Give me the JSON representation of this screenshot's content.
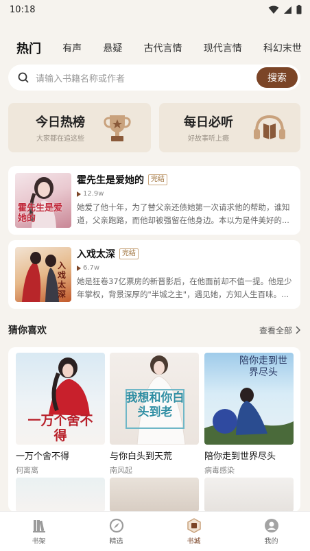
{
  "status": {
    "time": "10:18"
  },
  "tabs": [
    {
      "label": "热门",
      "active": true
    },
    {
      "label": "有声"
    },
    {
      "label": "悬疑"
    },
    {
      "label": "古代言情"
    },
    {
      "label": "现代言情"
    },
    {
      "label": "科幻末世"
    }
  ],
  "search": {
    "placeholder": "请输入书籍名称或作者",
    "button": "搜索"
  },
  "features": [
    {
      "title": "今日热榜",
      "subtitle": "大家都在追这些",
      "icon": "trophy-icon"
    },
    {
      "title": "每日必听",
      "subtitle": "好故事听上瘾",
      "icon": "headphones-book-icon"
    }
  ],
  "books": [
    {
      "title": "霍先生是爱她的",
      "badge": "完结",
      "plays": "12.9w",
      "desc": "她爱了他十年，为了替父亲还债她第一次请求他的帮助，谁知道，父亲跑路，而他却被强留在他身边。本以为是件美好的...",
      "cover_text": "霍先生是爱她的"
    },
    {
      "title": "入戏太深",
      "badge": "完结",
      "plays": "6.7w",
      "desc": "她是狂卷37亿票房的新晋影后，在他面前却不值一提。他是少年掌权，背景深厚的\"半城之主\"，遇见她，方知人生百味。...",
      "cover_text": "入戏太深"
    }
  ],
  "section": {
    "title": "猜你喜欢",
    "more": "查看全部"
  },
  "grid": [
    {
      "title": "一万个舍不得",
      "author": "何离离",
      "cover_text": "一万个舍不得"
    },
    {
      "title": "与你白头到天荒",
      "author": "南风起",
      "cover_text": "我想和你白头到老"
    },
    {
      "title": "陪你走到世界尽头",
      "author": "病毒感染",
      "cover_text": "陪你走到世界尽头"
    }
  ],
  "bottom_nav": [
    {
      "label": "书架",
      "icon": "bookshelf-icon"
    },
    {
      "label": "精选",
      "icon": "compass-icon"
    },
    {
      "label": "书城",
      "icon": "bookstore-icon",
      "active": true
    },
    {
      "label": "我的",
      "icon": "profile-icon"
    }
  ],
  "colors": {
    "accent": "#7b4527",
    "bg": "#f6f3ee",
    "feature_bg": "#efe7db"
  }
}
